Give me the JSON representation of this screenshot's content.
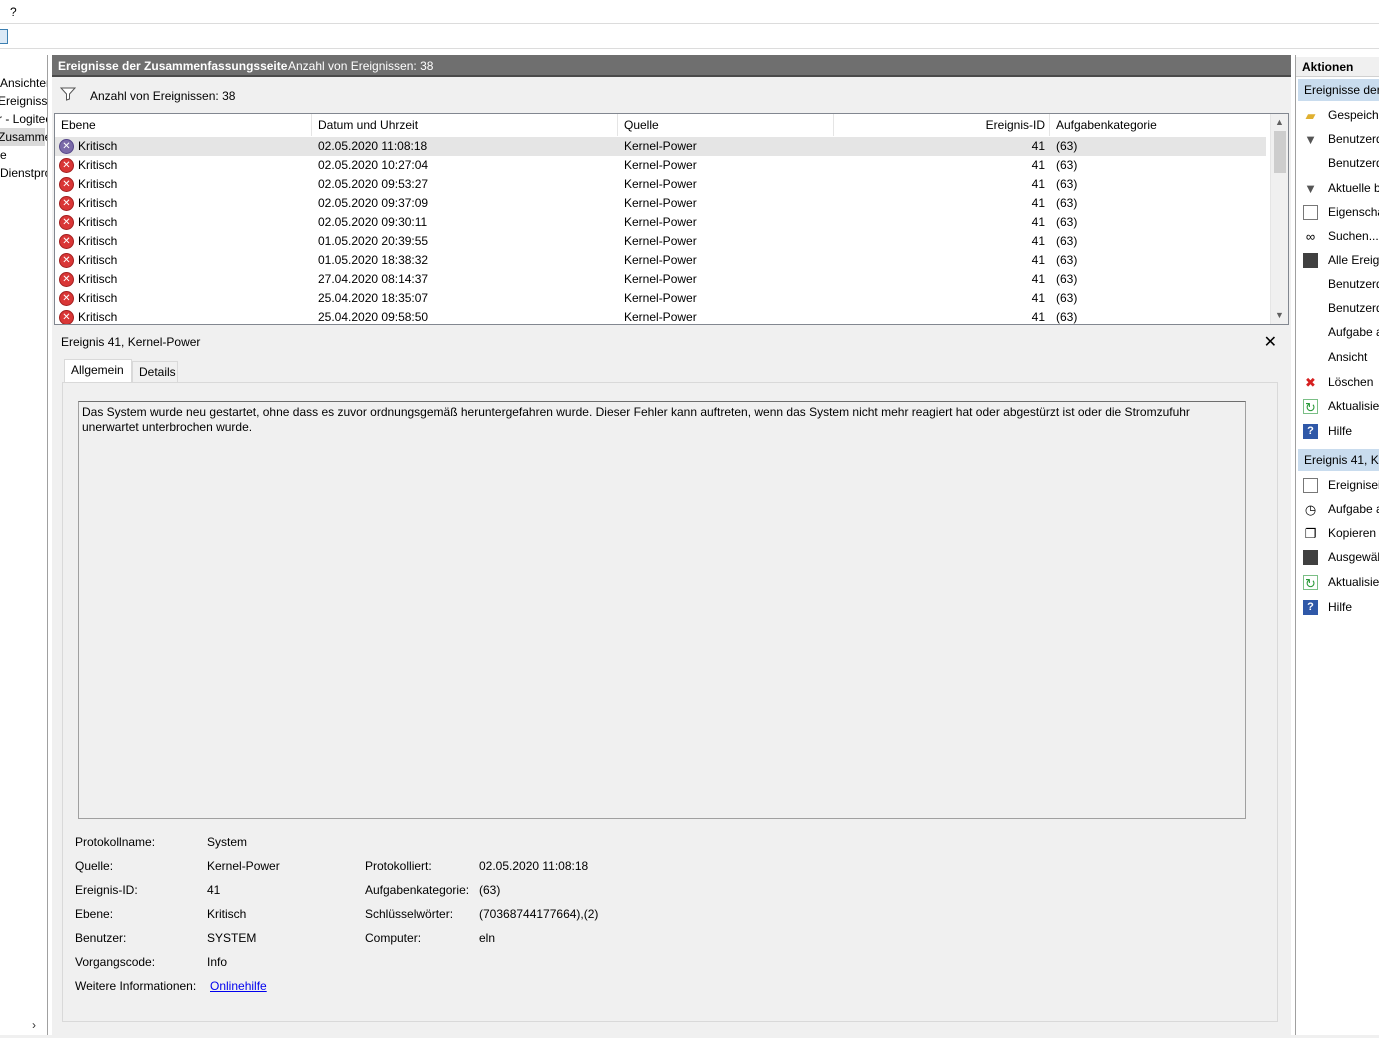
{
  "menu": {
    "help": "?"
  },
  "tree": {
    "items": [
      {
        "label": "Ansichten"
      },
      {
        "label": "Ereignisse"
      },
      {
        "label": "r - Logitech"
      },
      {
        "label": "Zusammenfassung"
      },
      {
        "label": "e"
      },
      {
        "label": "Dienstprotokolle"
      }
    ],
    "chevron": "›"
  },
  "main": {
    "title": "Ereignisse der Zusammenfassungsseite",
    "count": "Anzahl von Ereignissen: 38",
    "filter_text": "Anzahl von Ereignissen: 38"
  },
  "table": {
    "columns": [
      "Ebene",
      "Datum und Uhrzeit",
      "Quelle",
      "Ereignis-ID",
      "Aufgabenkategorie"
    ],
    "rows": [
      {
        "level": "Kritisch",
        "datetime": "02.05.2020 11:08:18",
        "source": "Kernel-Power",
        "id": "41",
        "category": "(63)"
      },
      {
        "level": "Kritisch",
        "datetime": "02.05.2020 10:27:04",
        "source": "Kernel-Power",
        "id": "41",
        "category": "(63)"
      },
      {
        "level": "Kritisch",
        "datetime": "02.05.2020 09:53:27",
        "source": "Kernel-Power",
        "id": "41",
        "category": "(63)"
      },
      {
        "level": "Kritisch",
        "datetime": "02.05.2020 09:37:09",
        "source": "Kernel-Power",
        "id": "41",
        "category": "(63)"
      },
      {
        "level": "Kritisch",
        "datetime": "02.05.2020 09:30:11",
        "source": "Kernel-Power",
        "id": "41",
        "category": "(63)"
      },
      {
        "level": "Kritisch",
        "datetime": "01.05.2020 20:39:55",
        "source": "Kernel-Power",
        "id": "41",
        "category": "(63)"
      },
      {
        "level": "Kritisch",
        "datetime": "01.05.2020 18:38:32",
        "source": "Kernel-Power",
        "id": "41",
        "category": "(63)"
      },
      {
        "level": "Kritisch",
        "datetime": "27.04.2020 08:14:37",
        "source": "Kernel-Power",
        "id": "41",
        "category": "(63)"
      },
      {
        "level": "Kritisch",
        "datetime": "25.04.2020 18:35:07",
        "source": "Kernel-Power",
        "id": "41",
        "category": "(63)"
      },
      {
        "level": "Kritisch",
        "datetime": "25.04.2020 09:58:50",
        "source": "Kernel-Power",
        "id": "41",
        "category": "(63)"
      }
    ]
  },
  "detail": {
    "title": "Ereignis 41, Kernel-Power",
    "close": "✕",
    "tabs": [
      "Allgemein",
      "Details"
    ],
    "description": "Das System wurde neu gestartet, ohne dass es zuvor ordnungsgemäß heruntergefahren wurde. Dieser Fehler kann auftreten, wenn das System nicht mehr reagiert hat oder abgestürzt ist oder die Stromzufuhr unerwartet unterbrochen wurde.",
    "props": {
      "log_label": "Protokollname:",
      "log_value": "System",
      "source_label": "Quelle:",
      "source_value": "Kernel-Power",
      "logged_label": "Protokolliert:",
      "logged_value": "02.05.2020 11:08:18",
      "id_label": "Ereignis-ID:",
      "id_value": "41",
      "cat_label": "Aufgabenkategorie:",
      "cat_value": "(63)",
      "level_label": "Ebene:",
      "level_value": "Kritisch",
      "kw_label": "Schlüsselwörter:",
      "kw_value": "(70368744177664),(2)",
      "user_label": "Benutzer:",
      "user_value": "SYSTEM",
      "computer_label": "Computer:",
      "computer_value": "eln",
      "opcode_label": "Vorgangscode:",
      "opcode_value": "Info",
      "more_label": "Weitere Informationen:",
      "more_link": "Onlinehilfe"
    }
  },
  "actions": {
    "header": "Aktionen",
    "section1": "Ereignisse der",
    "items1": [
      {
        "icon": "folder-icon",
        "label": "Gespeiche"
      },
      {
        "icon": "filter-icon",
        "label": "Benutzerd"
      },
      {
        "icon": "",
        "label": "Benutzerd"
      },
      {
        "icon": "filter-icon",
        "label": "Aktuelle b"
      },
      {
        "icon": "document-icon",
        "label": "Eigenscha"
      },
      {
        "icon": "binoculars-icon",
        "label": "Suchen..."
      },
      {
        "icon": "save-icon",
        "label": "Alle Ereig"
      },
      {
        "icon": "",
        "label": "Benutzerd"
      },
      {
        "icon": "",
        "label": "Benutzerd"
      },
      {
        "icon": "",
        "label": "Aufgabe a"
      },
      {
        "icon": "",
        "label": "Ansicht"
      },
      {
        "icon": "delete-icon",
        "label": "Löschen"
      },
      {
        "icon": "refresh-icon",
        "label": "Aktualisie"
      },
      {
        "icon": "help-icon",
        "label": "Hilfe"
      }
    ],
    "section2": "Ereignis 41, Ke",
    "items2": [
      {
        "icon": "document-icon",
        "label": "Ereignisei"
      },
      {
        "icon": "task-icon",
        "label": "Aufgabe a"
      },
      {
        "icon": "copy-icon",
        "label": "Kopieren"
      },
      {
        "icon": "save-icon",
        "label": "Ausgewäh"
      },
      {
        "icon": "refresh-icon",
        "label": "Aktualisie"
      },
      {
        "icon": "help-icon",
        "label": "Hilfe"
      }
    ]
  }
}
